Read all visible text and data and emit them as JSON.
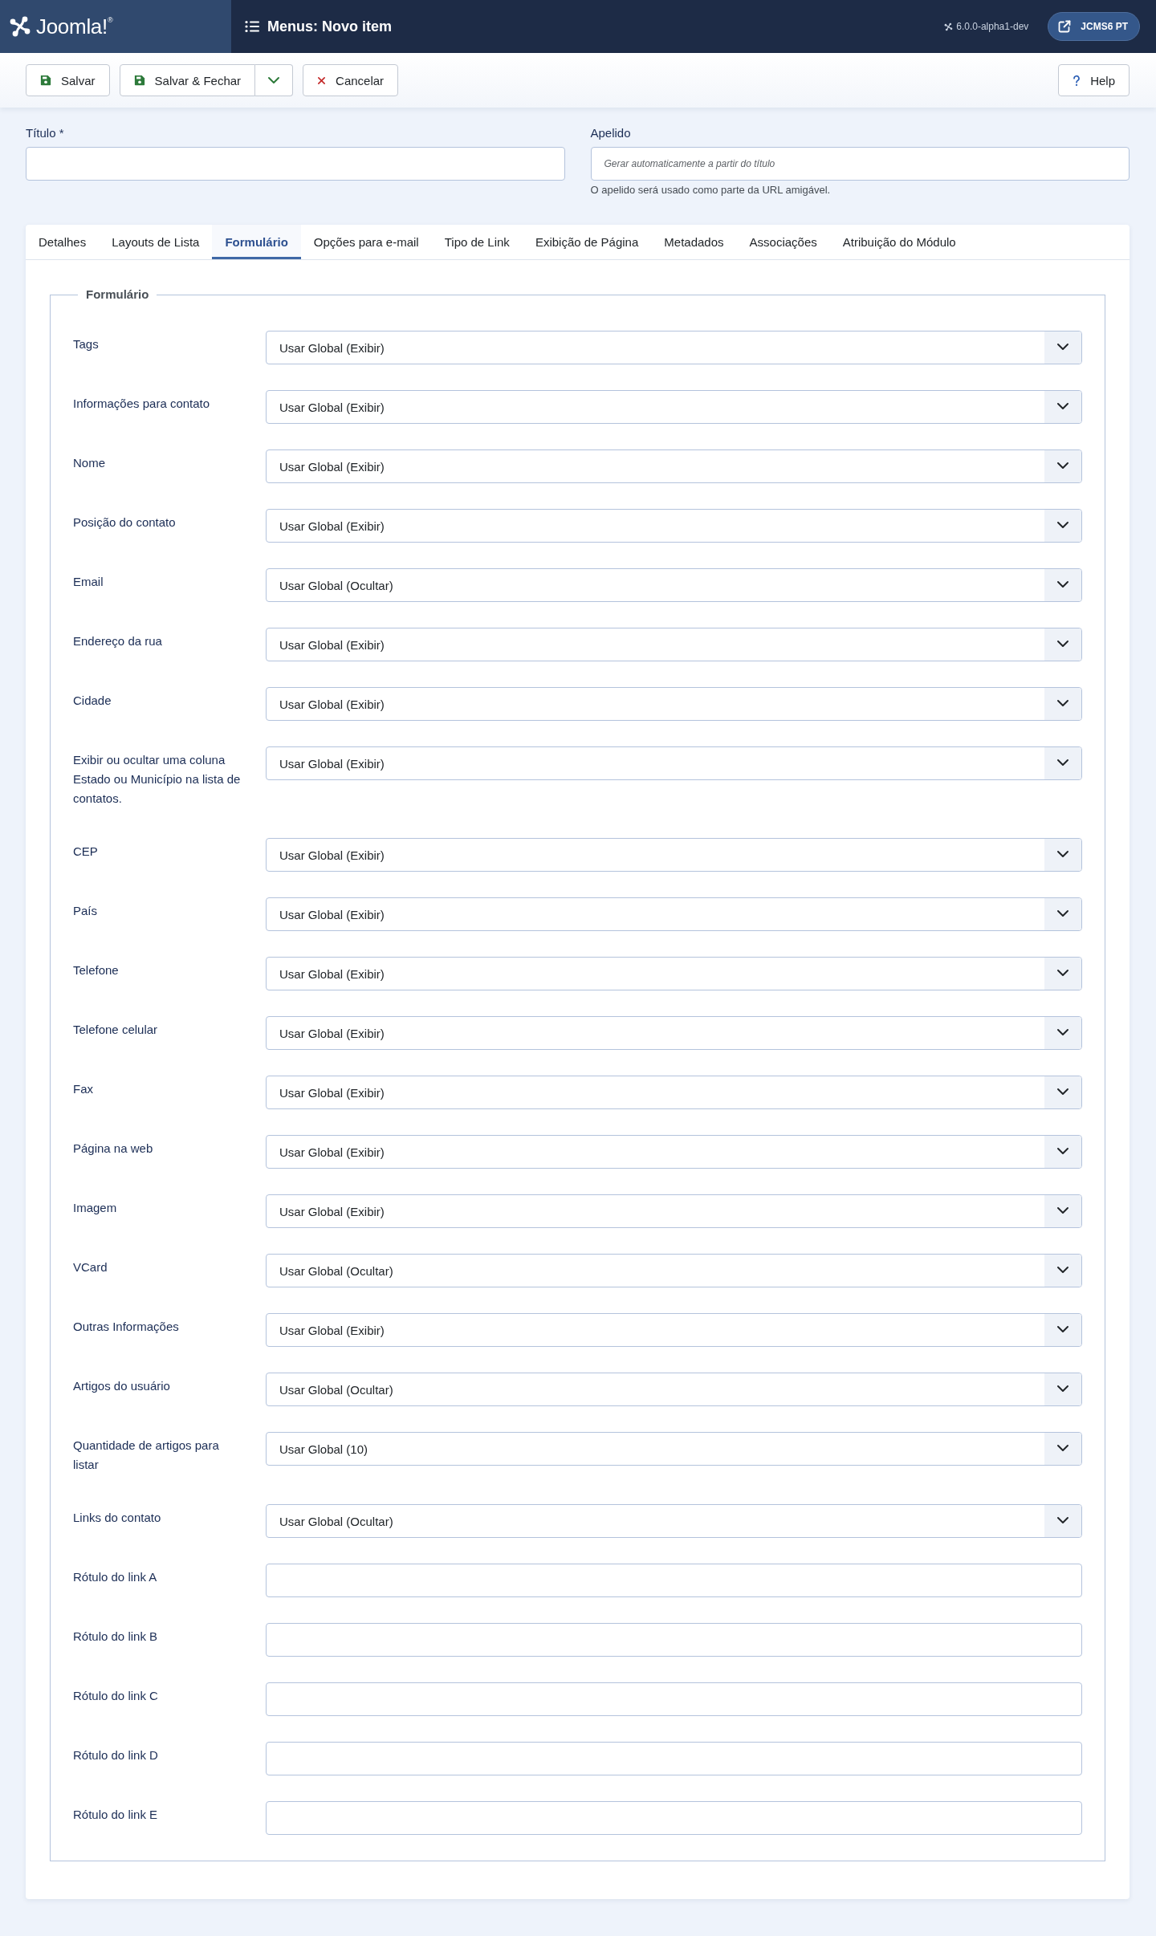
{
  "header": {
    "logo": "Joomla!$^{®}$",
    "title": "Menus: Novo item",
    "version": "6.0.0-alpha1-dev",
    "user_button": "JCMS6 PT"
  },
  "toolbar": {
    "buttons": [
      {
        "kind": "save",
        "label": "Salvar"
      },
      {
        "kind": "save_split",
        "label": "Salvar & Fechar"
      },
      {
        "kind": "cancel",
        "label": "Cancelar"
      },
      {
        "kind": "help",
        "label": "Help"
      }
    ]
  },
  "top_fields": [
    {
      "label": "Título *"
    },
    {
      "label": "Apelido",
      "placeholder": "Gerar automaticamente a partir do título",
      "hint": "O apelido será usado como parte da URL amigável."
    }
  ],
  "tabs": [
    {
      "label": "Detalhes",
      "selected": false
    },
    {
      "label": "Layouts de Lista",
      "selected": false
    },
    {
      "label": "Formulário",
      "selected": true
    },
    {
      "label": "Opções para e-mail",
      "selected": false
    },
    {
      "label": "Tipo de Link",
      "selected": false
    },
    {
      "label": "Exibição de Página",
      "selected": false
    },
    {
      "label": "Metadados",
      "selected": false
    },
    {
      "label": "Associações",
      "selected": false
    },
    {
      "label": "Atribuição do Módulo",
      "selected": false
    }
  ],
  "fieldset": {
    "legend": "Formulário",
    "fields": [
      {
        "label": "Tags",
        "kind": "select",
        "value": "Usar Global (Exibir)"
      },
      {
        "label": "Informações para contato",
        "kind": "select",
        "value": "Usar Global (Exibir)"
      },
      {
        "label": "Nome",
        "kind": "select",
        "value": "Usar Global (Exibir)"
      },
      {
        "label": "Posição do contato",
        "kind": "select",
        "value": "Usar Global (Exibir)"
      },
      {
        "label": "Email",
        "kind": "select",
        "value": "Usar Global (Ocultar)"
      },
      {
        "label": "Endereço da rua",
        "kind": "select",
        "value": "Usar Global (Exibir)"
      },
      {
        "label": "Cidade",
        "kind": "select",
        "value": "Usar Global (Exibir)"
      },
      {
        "label": "Exibir ou ocultar uma coluna Estado ou Município na lista de contatos.",
        "kind": "select",
        "value": "Usar Global (Exibir)"
      },
      {
        "label": "CEP",
        "kind": "select",
        "value": "Usar Global (Exibir)"
      },
      {
        "label": "País",
        "kind": "select",
        "value": "Usar Global (Exibir)"
      },
      {
        "label": "Telefone",
        "kind": "select",
        "value": "Usar Global (Exibir)"
      },
      {
        "label": "Telefone celular",
        "kind": "select",
        "value": "Usar Global (Exibir)"
      },
      {
        "label": "Fax",
        "kind": "select",
        "value": "Usar Global (Exibir)"
      },
      {
        "label": "Página na web",
        "kind": "select",
        "value": "Usar Global (Exibir)"
      },
      {
        "label": "Imagem",
        "kind": "select",
        "value": "Usar Global (Exibir)"
      },
      {
        "label": "VCard",
        "kind": "select",
        "value": "Usar Global (Ocultar)"
      },
      {
        "label": "Outras Informações",
        "kind": "select",
        "value": "Usar Global (Exibir)"
      },
      {
        "label": "Artigos do usuário",
        "kind": "select",
        "value": "Usar Global (Ocultar)"
      },
      {
        "label": "Quantidade de artigos para listar",
        "kind": "select",
        "value": "Usar Global (10)"
      },
      {
        "label": "Links do contato",
        "kind": "select",
        "value": "Usar Global (Ocultar)"
      },
      {
        "label": "Rótulo do link A",
        "kind": "text"
      },
      {
        "label": "Rótulo do link B",
        "kind": "text"
      },
      {
        "label": "Rótulo do link C",
        "kind": "text"
      },
      {
        "label": "Rótulo do link D",
        "kind": "text"
      },
      {
        "label": "Rótulo do link E",
        "kind": "text"
      }
    ]
  }
}
